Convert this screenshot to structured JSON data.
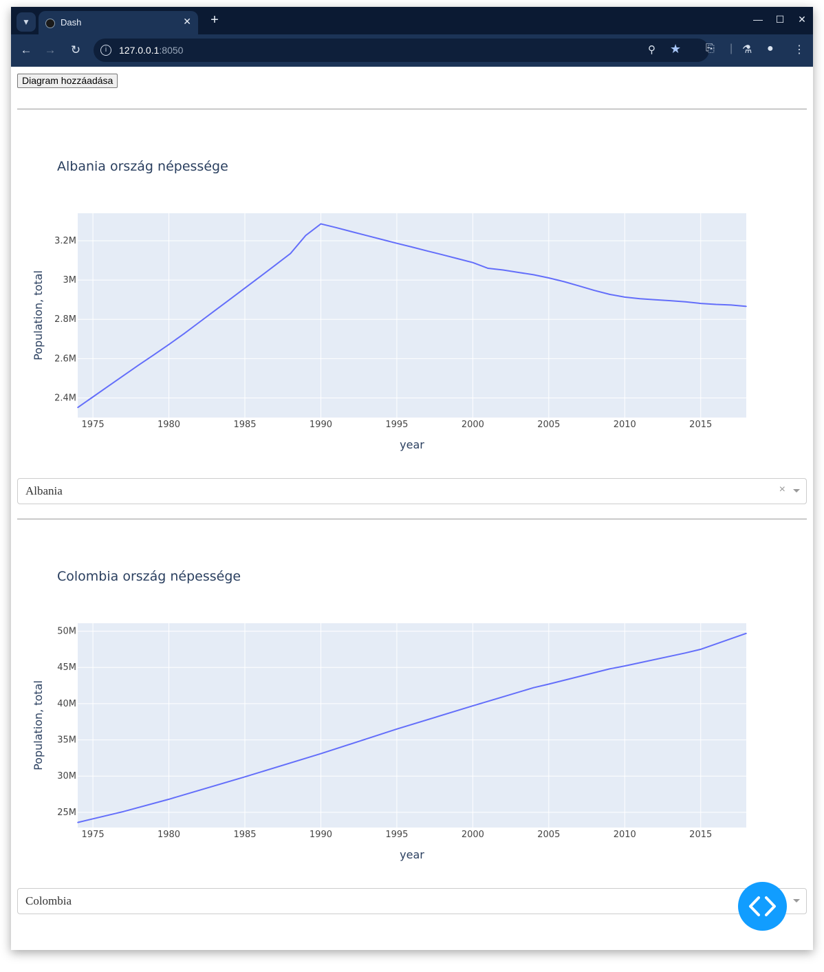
{
  "browser": {
    "tab_title": "Dash",
    "url_host": "127.0.0.1",
    "url_port": ":8050"
  },
  "page": {
    "add_button_label": "Diagram hozzáadása"
  },
  "charts": [
    {
      "title": "Albania ország népessége",
      "dropdown_value": "Albania",
      "chart_data": {
        "type": "line",
        "title": "Albania ország népessége",
        "xlabel": "year",
        "ylabel": "Population, total",
        "xlim": [
          1974,
          2018
        ],
        "ylim": [
          2.3,
          3.34
        ],
        "y_unit": "M",
        "x_ticks": [
          1975,
          1980,
          1985,
          1990,
          1995,
          2000,
          2005,
          2010,
          2015
        ],
        "y_ticks": [
          {
            "v": 2.4,
            "label": "2.4M"
          },
          {
            "v": 2.6,
            "label": "2.6M"
          },
          {
            "v": 2.8,
            "label": "2.8M"
          },
          {
            "v": 3.0,
            "label": "3M"
          },
          {
            "v": 3.2,
            "label": "3.2M"
          }
        ],
        "x": [
          1974,
          1975,
          1976,
          1977,
          1978,
          1979,
          1980,
          1981,
          1982,
          1983,
          1984,
          1985,
          1986,
          1987,
          1988,
          1989,
          1990,
          1991,
          1992,
          1993,
          1994,
          1995,
          1996,
          1997,
          1998,
          1999,
          2000,
          2001,
          2002,
          2003,
          2004,
          2005,
          2006,
          2007,
          2008,
          2009,
          2010,
          2011,
          2012,
          2013,
          2014,
          2015,
          2016,
          2017,
          2018
        ],
        "y": [
          2.351,
          2.405,
          2.459,
          2.513,
          2.567,
          2.619,
          2.672,
          2.727,
          2.785,
          2.843,
          2.901,
          2.959,
          3.017,
          3.076,
          3.135,
          3.227,
          3.286,
          3.267,
          3.247,
          3.227,
          3.207,
          3.187,
          3.168,
          3.148,
          3.129,
          3.109,
          3.089,
          3.06,
          3.051,
          3.039,
          3.027,
          3.011,
          2.992,
          2.97,
          2.947,
          2.927,
          2.913,
          2.905,
          2.9,
          2.895,
          2.889,
          2.881,
          2.876,
          2.873,
          2.866
        ],
        "line_color": "#636efa",
        "plot_bg": "#e5ecf6"
      }
    },
    {
      "title": "Colombia ország népessége",
      "dropdown_value": "Colombia",
      "chart_data": {
        "type": "line",
        "title": "Colombia ország népessége",
        "xlabel": "year",
        "ylabel": "Population, total",
        "xlim": [
          1974,
          2018
        ],
        "ylim": [
          22.9,
          51.1
        ],
        "y_unit": "M",
        "x_ticks": [
          1975,
          1980,
          1985,
          1990,
          1995,
          2000,
          2005,
          2010,
          2015
        ],
        "y_ticks": [
          {
            "v": 25,
            "label": "25M"
          },
          {
            "v": 30,
            "label": "30M"
          },
          {
            "v": 35,
            "label": "35M"
          },
          {
            "v": 40,
            "label": "40M"
          },
          {
            "v": 45,
            "label": "45M"
          },
          {
            "v": 50,
            "label": "50M"
          }
        ],
        "x": [
          1974,
          1977,
          1980,
          1985,
          1990,
          1995,
          2000,
          2004,
          2005,
          2009,
          2010,
          2014,
          2015,
          2018
        ],
        "y": [
          23.6,
          25.1,
          26.8,
          29.9,
          33.1,
          36.5,
          39.7,
          42.2,
          42.7,
          44.8,
          45.2,
          47.0,
          47.5,
          49.7
        ],
        "line_color": "#636efa",
        "plot_bg": "#e5ecf6"
      }
    }
  ]
}
